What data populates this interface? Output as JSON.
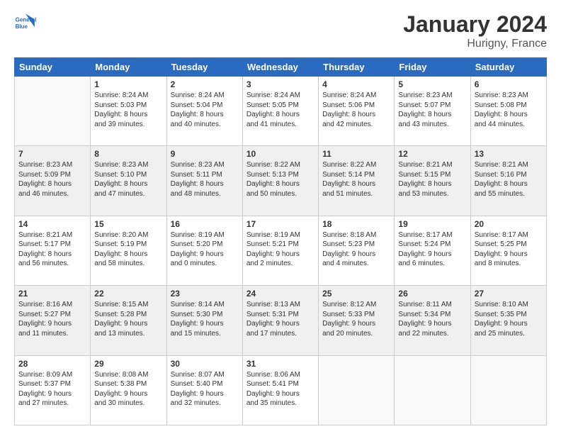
{
  "header": {
    "logo_line1": "General",
    "logo_line2": "Blue",
    "month": "January 2024",
    "location": "Hurigny, France"
  },
  "weekdays": [
    "Sunday",
    "Monday",
    "Tuesday",
    "Wednesday",
    "Thursday",
    "Friday",
    "Saturday"
  ],
  "weeks": [
    [
      {
        "day": "",
        "info": ""
      },
      {
        "day": "1",
        "info": "Sunrise: 8:24 AM\nSunset: 5:03 PM\nDaylight: 8 hours\nand 39 minutes."
      },
      {
        "day": "2",
        "info": "Sunrise: 8:24 AM\nSunset: 5:04 PM\nDaylight: 8 hours\nand 40 minutes."
      },
      {
        "day": "3",
        "info": "Sunrise: 8:24 AM\nSunset: 5:05 PM\nDaylight: 8 hours\nand 41 minutes."
      },
      {
        "day": "4",
        "info": "Sunrise: 8:24 AM\nSunset: 5:06 PM\nDaylight: 8 hours\nand 42 minutes."
      },
      {
        "day": "5",
        "info": "Sunrise: 8:23 AM\nSunset: 5:07 PM\nDaylight: 8 hours\nand 43 minutes."
      },
      {
        "day": "6",
        "info": "Sunrise: 8:23 AM\nSunset: 5:08 PM\nDaylight: 8 hours\nand 44 minutes."
      }
    ],
    [
      {
        "day": "7",
        "info": ""
      },
      {
        "day": "8",
        "info": "Sunrise: 8:23 AM\nSunset: 5:10 PM\nDaylight: 8 hours\nand 47 minutes."
      },
      {
        "day": "9",
        "info": "Sunrise: 8:23 AM\nSunset: 5:11 PM\nDaylight: 8 hours\nand 48 minutes."
      },
      {
        "day": "10",
        "info": "Sunrise: 8:22 AM\nSunset: 5:13 PM\nDaylight: 8 hours\nand 50 minutes."
      },
      {
        "day": "11",
        "info": "Sunrise: 8:22 AM\nSunset: 5:14 PM\nDaylight: 8 hours\nand 51 minutes."
      },
      {
        "day": "12",
        "info": "Sunrise: 8:21 AM\nSunset: 5:15 PM\nDaylight: 8 hours\nand 53 minutes."
      },
      {
        "day": "13",
        "info": "Sunrise: 8:21 AM\nSunset: 5:16 PM\nDaylight: 8 hours\nand 55 minutes."
      }
    ],
    [
      {
        "day": "14",
        "info": ""
      },
      {
        "day": "15",
        "info": "Sunrise: 8:20 AM\nSunset: 5:19 PM\nDaylight: 8 hours\nand 58 minutes."
      },
      {
        "day": "16",
        "info": "Sunrise: 8:19 AM\nSunset: 5:20 PM\nDaylight: 9 hours\nand 0 minutes."
      },
      {
        "day": "17",
        "info": "Sunrise: 8:19 AM\nSunset: 5:21 PM\nDaylight: 9 hours\nand 2 minutes."
      },
      {
        "day": "18",
        "info": "Sunrise: 8:18 AM\nSunset: 5:23 PM\nDaylight: 9 hours\nand 4 minutes."
      },
      {
        "day": "19",
        "info": "Sunrise: 8:17 AM\nSunset: 5:24 PM\nDaylight: 9 hours\nand 6 minutes."
      },
      {
        "day": "20",
        "info": "Sunrise: 8:17 AM\nSunset: 5:25 PM\nDaylight: 9 hours\nand 8 minutes."
      }
    ],
    [
      {
        "day": "21",
        "info": ""
      },
      {
        "day": "22",
        "info": "Sunrise: 8:15 AM\nSunset: 5:28 PM\nDaylight: 9 hours\nand 13 minutes."
      },
      {
        "day": "23",
        "info": "Sunrise: 8:14 AM\nSunset: 5:30 PM\nDaylight: 9 hours\nand 15 minutes."
      },
      {
        "day": "24",
        "info": "Sunrise: 8:13 AM\nSunset: 5:31 PM\nDaylight: 9 hours\nand 17 minutes."
      },
      {
        "day": "25",
        "info": "Sunrise: 8:12 AM\nSunset: 5:33 PM\nDaylight: 9 hours\nand 20 minutes."
      },
      {
        "day": "26",
        "info": "Sunrise: 8:11 AM\nSunset: 5:34 PM\nDaylight: 9 hours\nand 22 minutes."
      },
      {
        "day": "27",
        "info": "Sunrise: 8:10 AM\nSunset: 5:35 PM\nDaylight: 9 hours\nand 25 minutes."
      }
    ],
    [
      {
        "day": "28",
        "info": ""
      },
      {
        "day": "29",
        "info": "Sunrise: 8:08 AM\nSunset: 5:38 PM\nDaylight: 9 hours\nand 30 minutes."
      },
      {
        "day": "30",
        "info": "Sunrise: 8:07 AM\nSunset: 5:40 PM\nDaylight: 9 hours\nand 32 minutes."
      },
      {
        "day": "31",
        "info": "Sunrise: 8:06 AM\nSunset: 5:41 PM\nDaylight: 9 hours\nand 35 minutes."
      },
      {
        "day": "",
        "info": ""
      },
      {
        "day": "",
        "info": ""
      },
      {
        "day": "",
        "info": ""
      }
    ]
  ],
  "week_day_infos": {
    "7": "Sunrise: 8:23 AM\nSunset: 5:09 PM\nDaylight: 8 hours\nand 46 minutes.",
    "14": "Sunrise: 8:21 AM\nSunset: 5:17 PM\nDaylight: 8 hours\nand 56 minutes.",
    "21": "Sunrise: 8:16 AM\nSunset: 5:27 PM\nDaylight: 9 hours\nand 11 minutes.",
    "28": "Sunrise: 8:09 AM\nSunset: 5:37 PM\nDaylight: 9 hours\nand 27 minutes."
  }
}
